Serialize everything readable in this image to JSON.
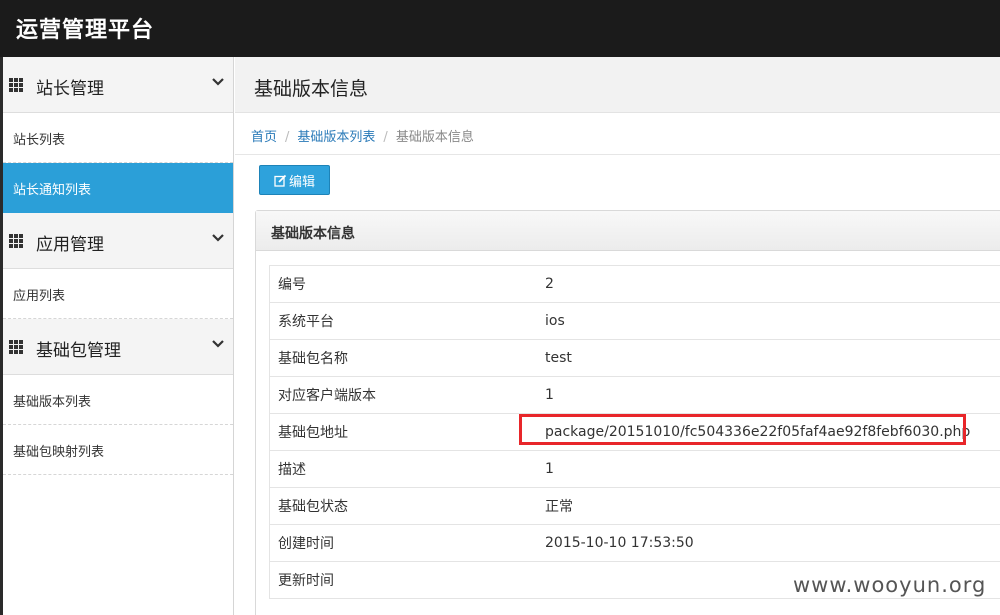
{
  "app": {
    "title": "运营管理平台"
  },
  "sidebar": {
    "groups": [
      {
        "label": "站长管理",
        "items": [
          {
            "label": "站长列表"
          },
          {
            "label": "站长通知列表"
          }
        ]
      },
      {
        "label": "应用管理",
        "items": [
          {
            "label": "应用列表"
          }
        ]
      },
      {
        "label": "基础包管理",
        "items": [
          {
            "label": "基础版本列表"
          },
          {
            "label": "基础包映射列表"
          }
        ]
      }
    ],
    "active_item": "站长通知列表"
  },
  "page": {
    "title": "基础版本信息",
    "breadcrumb": [
      "首页",
      "基础版本列表",
      "基础版本信息"
    ],
    "edit_button": "编辑",
    "panel_title": "基础版本信息",
    "rows": [
      {
        "key": "编号",
        "value": "2"
      },
      {
        "key": "系统平台",
        "value": "ios"
      },
      {
        "key": "基础包名称",
        "value": "test"
      },
      {
        "key": "对应客户端版本",
        "value": "1"
      },
      {
        "key": "基础包地址",
        "value": "package/20151010/fc504336e22f05faf4ae92f8febf6030.php"
      },
      {
        "key": "描述",
        "value": "1"
      },
      {
        "key": "基础包状态",
        "value": "正常"
      },
      {
        "key": "创建时间",
        "value": "2015-10-10 17:53:50"
      },
      {
        "key": "更新时间",
        "value": ""
      }
    ]
  },
  "watermark": "www.wooyun.org",
  "colors": {
    "topbar": "#1b1b1b",
    "accent": "#2b9fd8",
    "highlight": "#e8262a"
  }
}
